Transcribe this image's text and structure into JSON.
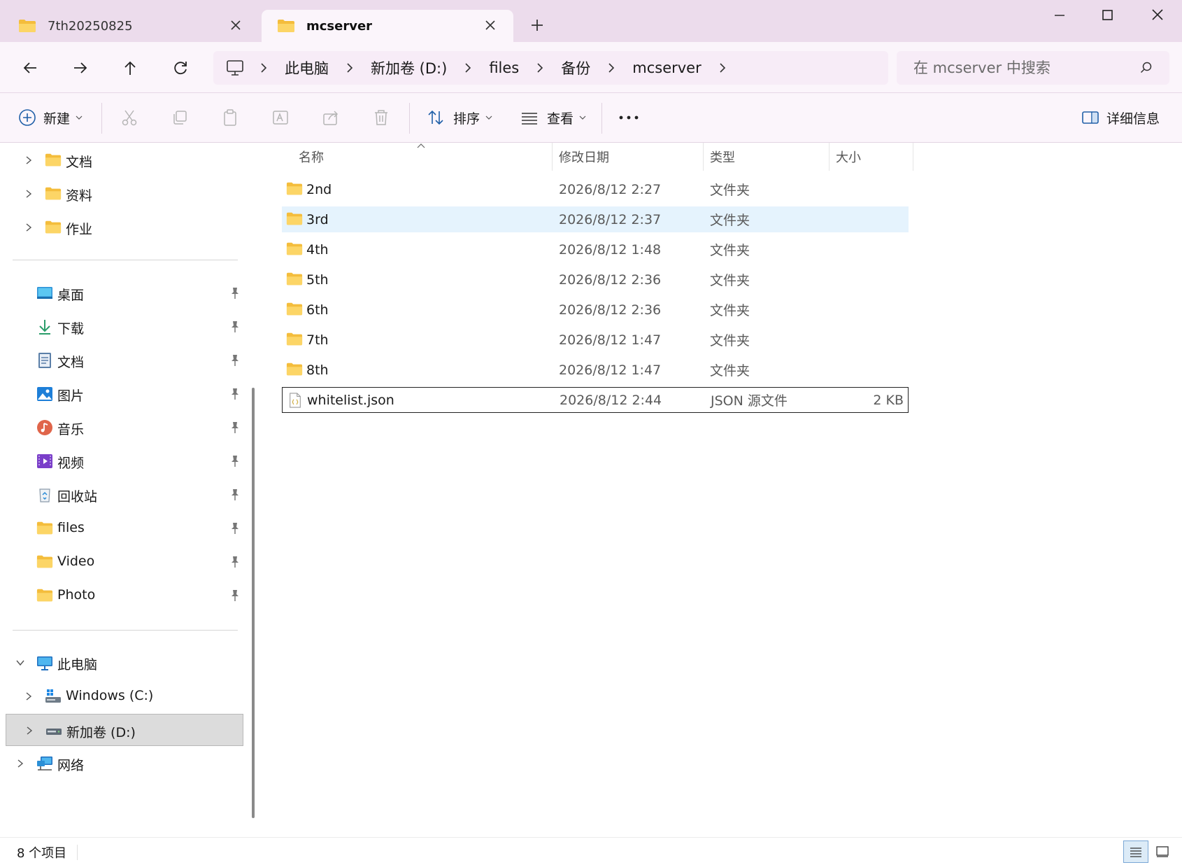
{
  "tabs": [
    {
      "label": "7th20250825",
      "active": false
    },
    {
      "label": "mcserver",
      "active": true
    }
  ],
  "breadcrumb": [
    "此电脑",
    "新加卷 (D:)",
    "files",
    "备份",
    "mcserver"
  ],
  "search": {
    "placeholder": "在 mcserver 中搜索"
  },
  "toolbar": {
    "new_label": "新建",
    "sort_label": "排序",
    "view_label": "查看",
    "details_label": "详细信息"
  },
  "sidebar": {
    "tree_folders": [
      {
        "label": "文档",
        "icon": "folder-icon"
      },
      {
        "label": "资料",
        "icon": "folder-icon"
      },
      {
        "label": "作业",
        "icon": "folder-icon"
      }
    ],
    "pinned": [
      {
        "label": "桌面",
        "icon": "desktop-icon"
      },
      {
        "label": "下载",
        "icon": "download-icon"
      },
      {
        "label": "文档",
        "icon": "documents-icon"
      },
      {
        "label": "图片",
        "icon": "pictures-icon"
      },
      {
        "label": "音乐",
        "icon": "music-icon"
      },
      {
        "label": "视频",
        "icon": "videos-icon"
      },
      {
        "label": "回收站",
        "icon": "recycle-bin-icon"
      },
      {
        "label": "files",
        "icon": "folder-icon"
      },
      {
        "label": "Video",
        "icon": "folder-icon"
      },
      {
        "label": "Photo",
        "icon": "folder-icon"
      }
    ],
    "this_pc": "此电脑",
    "drives": [
      {
        "label": "Windows (C:)",
        "icon": "windows-drive-icon"
      },
      {
        "label": "新加卷 (D:)",
        "icon": "drive-icon",
        "selected": true
      }
    ],
    "network": "网络"
  },
  "columns": {
    "name": "名称",
    "date": "修改日期",
    "type": "类型",
    "size": "大小"
  },
  "files": [
    {
      "name": "2nd",
      "date": "2026/8/12 2:27",
      "type": "文件夹",
      "size": ""
    },
    {
      "name": "3rd",
      "date": "2026/8/12 2:37",
      "type": "文件夹",
      "size": ""
    },
    {
      "name": "4th",
      "date": "2026/8/12 1:48",
      "type": "文件夹",
      "size": ""
    },
    {
      "name": "5th",
      "date": "2026/8/12 2:36",
      "type": "文件夹",
      "size": ""
    },
    {
      "name": "6th",
      "date": "2026/8/12 2:36",
      "type": "文件夹",
      "size": ""
    },
    {
      "name": "7th",
      "date": "2026/8/12 1:47",
      "type": "文件夹",
      "size": ""
    },
    {
      "name": "8th",
      "date": "2026/8/12 1:47",
      "type": "文件夹",
      "size": ""
    },
    {
      "name": "whitelist.json",
      "date": "2026/8/12 2:44",
      "type": "JSON 源文件",
      "size": "2 KB"
    }
  ],
  "status": {
    "count": "8 个项目"
  },
  "colors": {
    "titlebar": "#ecdcec",
    "toolbar": "#fbf5fb",
    "hover_row": "#e5f3fd",
    "folder": "#f7c948"
  }
}
